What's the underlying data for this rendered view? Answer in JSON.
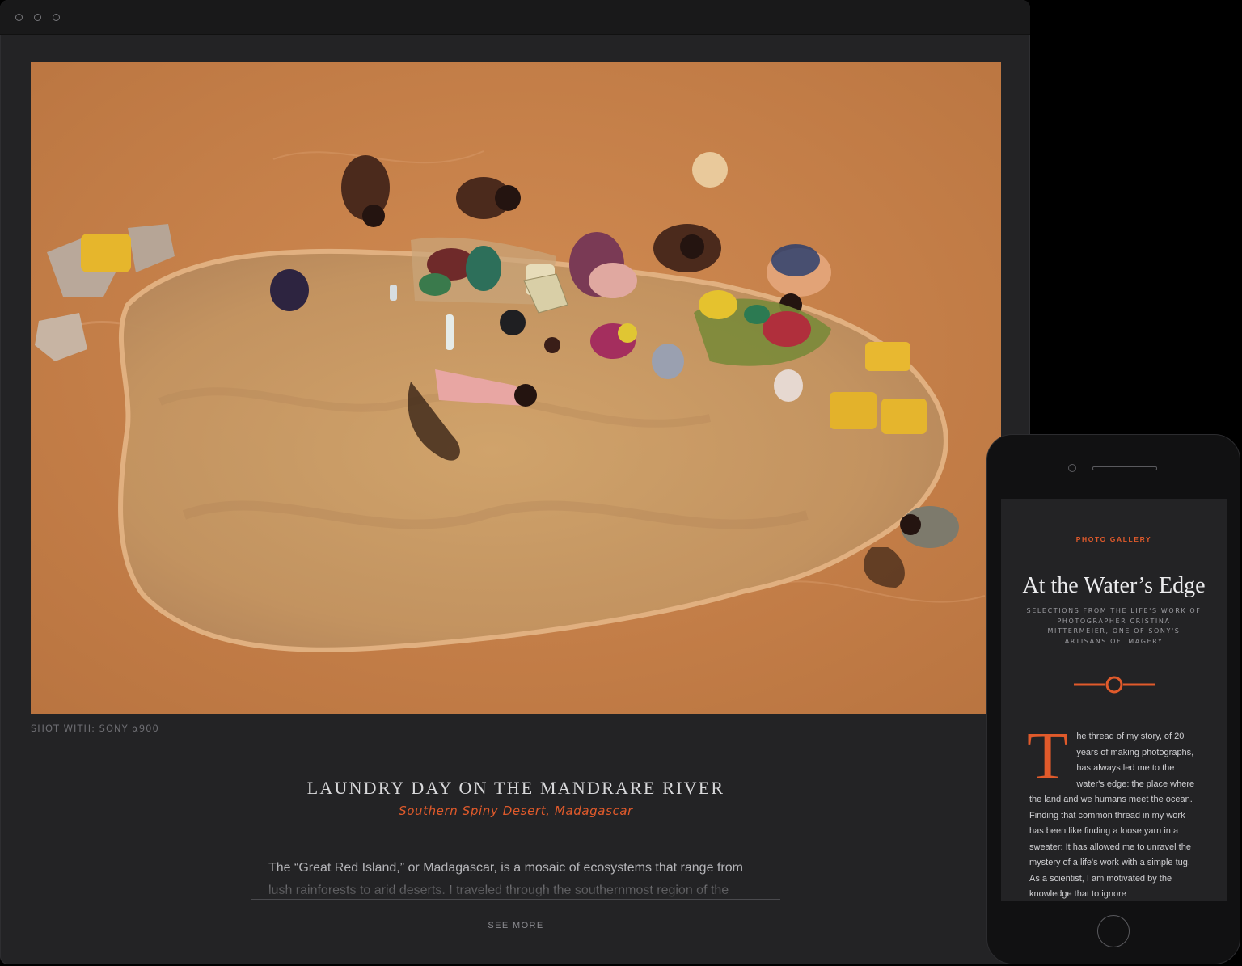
{
  "desktop": {
    "photo_caption": "SHOT WITH: SONY α900",
    "story": {
      "title": "LAUNDRY DAY ON THE MANDRARE RIVER",
      "location": "Southern Spiny Desert, Madagascar",
      "body": "The “Great Red Island,” or Madagascar, is a mosaic of ecosystems that range from lush rainforests to arid deserts. I traveled through the southernmost region of the island to",
      "see_more_label": "SEE MORE"
    }
  },
  "mobile": {
    "kicker": "PHOTO GALLERY",
    "title": "At the Water’s Edge",
    "subtitle": "SELECTIONS FROM THE LIFE'S WORK OF PHOTOGRAPHER CRISTINA MITTERMEIER, ONE OF SONY'S ARTISANS OF IMAGERY",
    "dropcap": "T",
    "body": "he thread of my story, of 20 years of making photographs, has always led me to the water's edge: the place where the land and we humans meet the ocean. Finding that common thread in my work has been like finding a loose yarn in a sweater: It has allowed me to unravel the mystery of a life's work with a simple tug. As a scientist, I am motivated by the knowledge that to ignore"
  },
  "colors": {
    "accent": "#e05a2b",
    "panel": "#232325",
    "river": "#c9834d",
    "sandbar": "#c99a66"
  }
}
